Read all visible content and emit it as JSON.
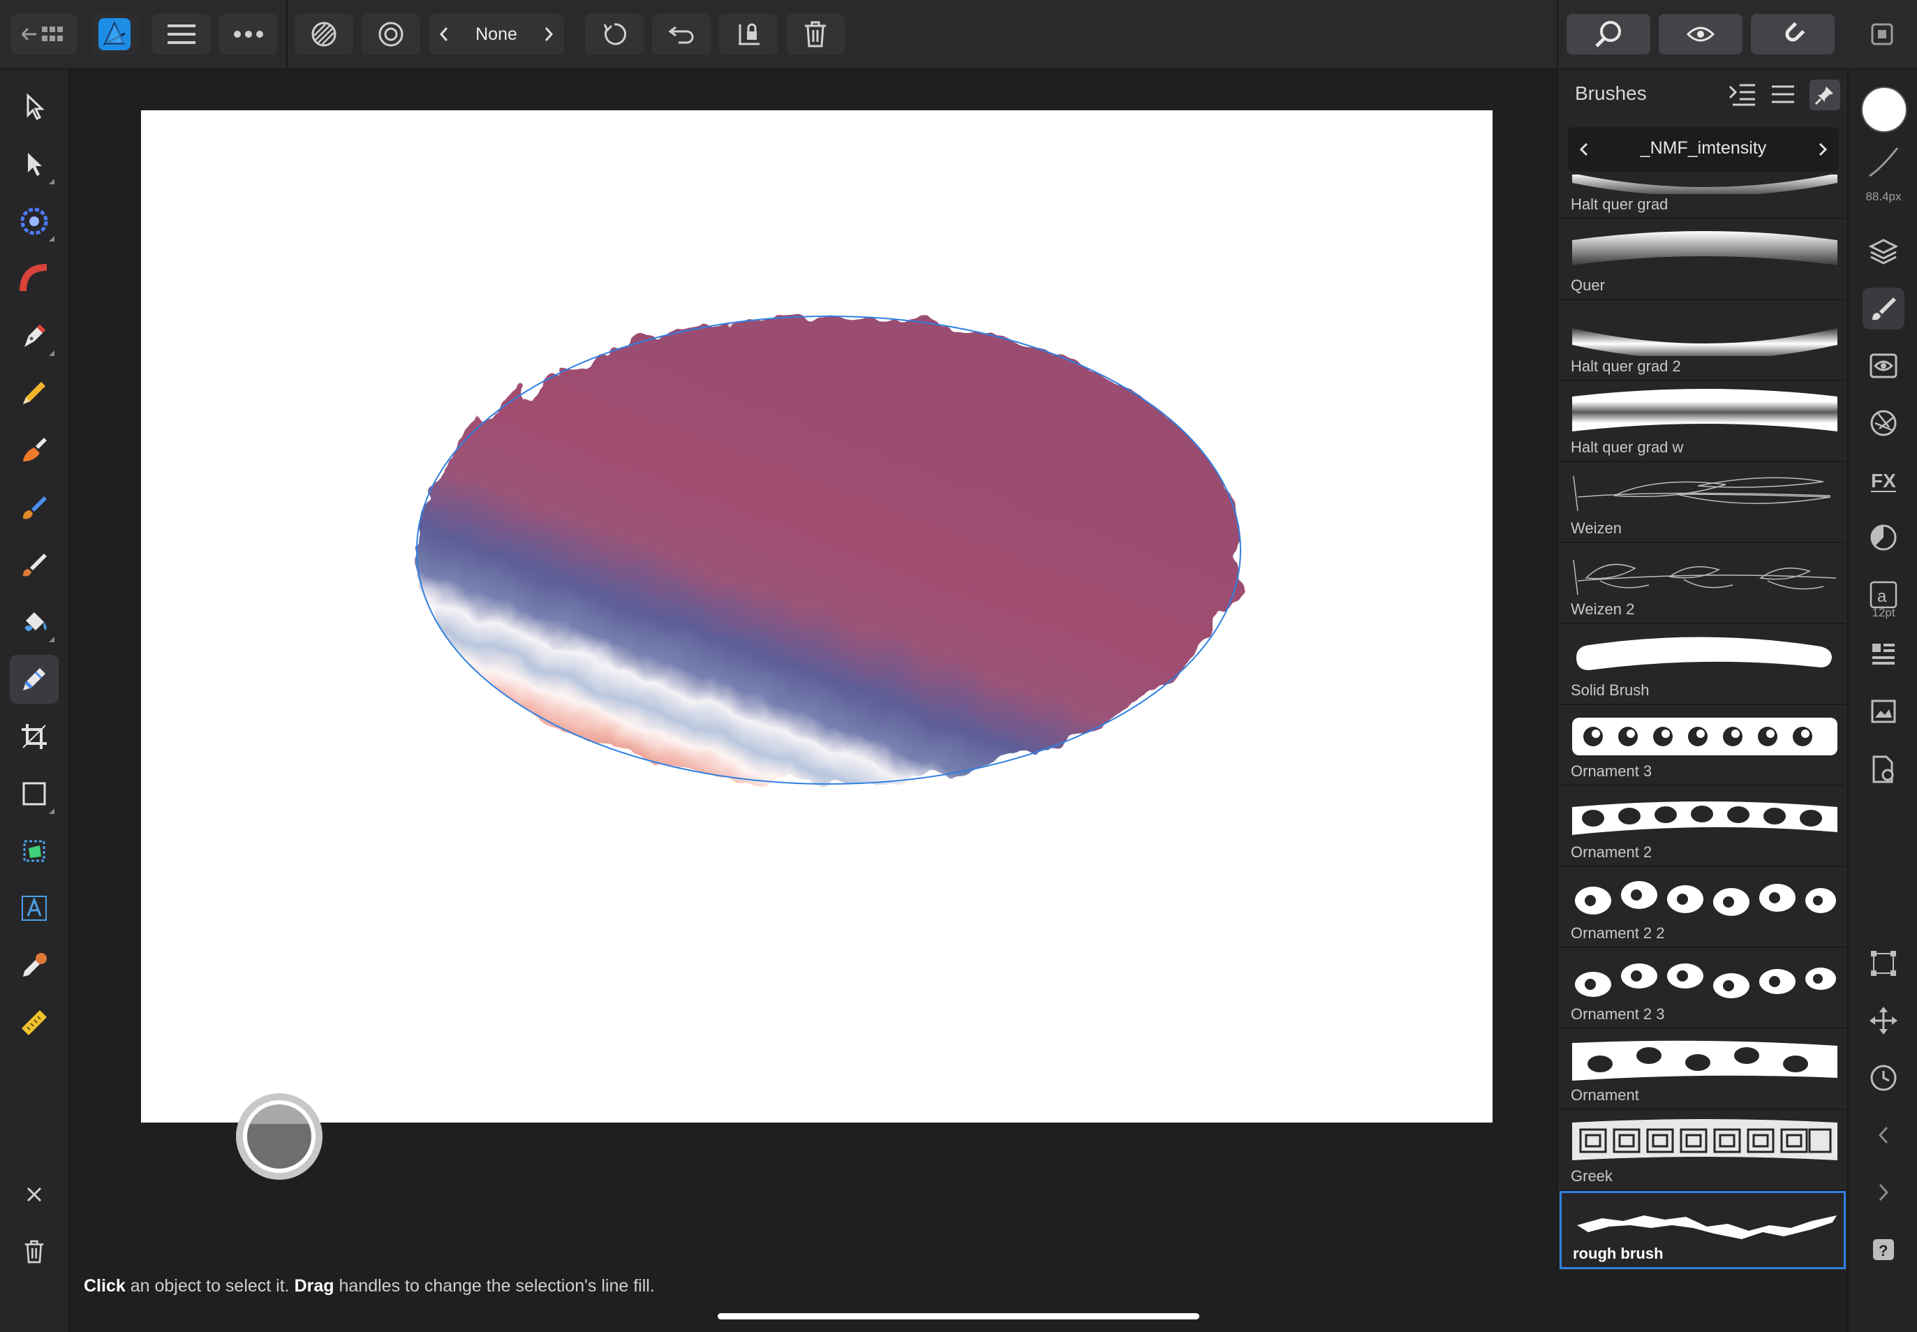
{
  "topbar": {
    "back_icon": "back-to-gallery-icon",
    "mode_selector": "None"
  },
  "brushes_panel": {
    "title": "Brushes",
    "category": "_NMF_imtensity",
    "brushes": [
      {
        "name": "Halt quer grad",
        "selected": false
      },
      {
        "name": "Quer",
        "selected": false
      },
      {
        "name": "Halt quer grad 2",
        "selected": false
      },
      {
        "name": "Halt quer grad w",
        "selected": false
      },
      {
        "name": "Weizen",
        "selected": false
      },
      {
        "name": "Weizen 2",
        "selected": false
      },
      {
        "name": "Solid Brush",
        "selected": false
      },
      {
        "name": "Ornament 3",
        "selected": false
      },
      {
        "name": "Ornament 2",
        "selected": false
      },
      {
        "name": "Ornament 2 2",
        "selected": false
      },
      {
        "name": "Ornament 2 3",
        "selected": false
      },
      {
        "name": "Ornament",
        "selected": false
      },
      {
        "name": "Greek",
        "selected": false
      },
      {
        "name": "rough brush",
        "selected": true
      }
    ]
  },
  "right_strip": {
    "brush_size": "88.4px",
    "text_size": "12pt"
  },
  "status": {
    "click": "Click",
    "click_rest": "an object to select it.",
    "drag": "Drag",
    "drag_rest": "handles to change the selection's line fill."
  },
  "colors": {
    "accent": "#2f7fe0",
    "canvas": "#ffffff",
    "ui_bg": "#262628"
  }
}
